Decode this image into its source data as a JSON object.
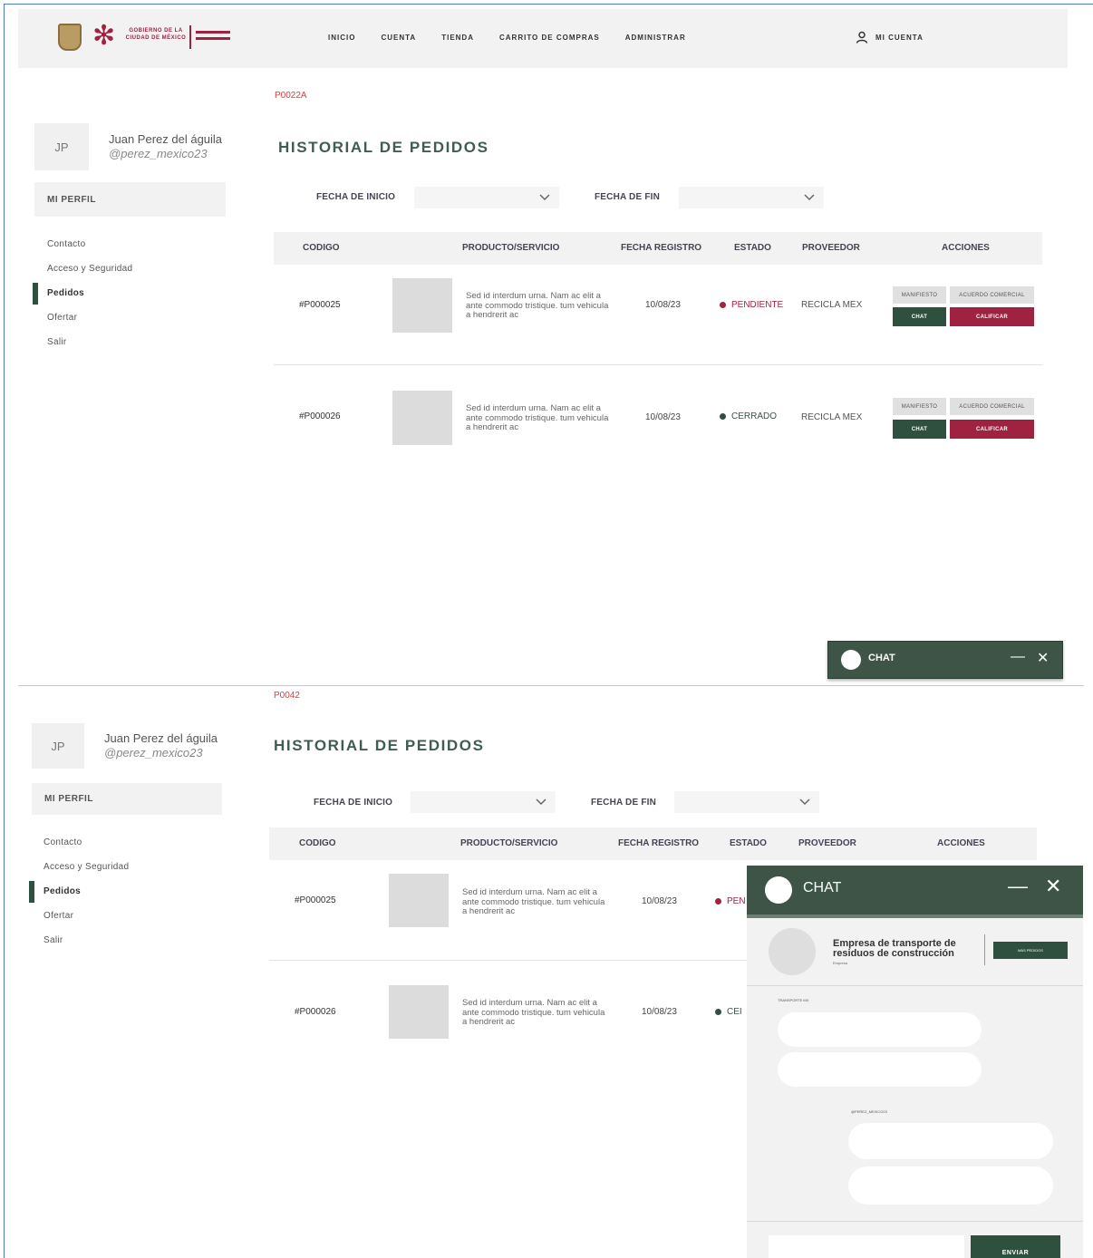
{
  "nav": {
    "logo_text": "GOBIERNO DE LA CIUDAD DE MÉXICO",
    "links": [
      "INICIO",
      "CUENTA",
      "TIENDA",
      "CARRITO DE COMPRAS",
      "ADMINISTRAR"
    ],
    "account_label": "MI CUENTA"
  },
  "frames": [
    {
      "code": "P0022A",
      "user": {
        "initials": "JP",
        "name": "Juan Perez del águila",
        "handle": "@perez_mexico23"
      },
      "profile_button": "MI PERFIL",
      "menu": [
        {
          "label": "Contacto",
          "active": false
        },
        {
          "label": "Acceso y Seguridad",
          "active": false
        },
        {
          "label": "Pedidos",
          "active": true
        },
        {
          "label": "Ofertar",
          "active": false
        },
        {
          "label": "Salir",
          "active": false
        }
      ],
      "title": "HISTORIAL DE PEDIDOS",
      "filters": {
        "start_label": "FECHA DE INICIO",
        "end_label": "FECHA DE FIN"
      },
      "columns": [
        "CODIGO",
        "PRODUCTO/SERVICIO",
        "FECHA REGISTRO",
        "ESTADO",
        "PROVEEDOR",
        "ACCIONES"
      ],
      "rows": [
        {
          "code": "#P000025",
          "description": "Sed id interdum urna. Nam ac elit a ante commodo tristique. tum vehicula a hendrerit ac",
          "date": "10/08/23",
          "status": "PENDIENTE",
          "provider": "RECICLA MEX",
          "actions": {
            "manifest": "MANIFIESTO",
            "agreement": "ACUERDO COMERCIAL",
            "chat": "CHAT",
            "rate": "CALIFICAR"
          }
        },
        {
          "code": "#P000026",
          "description": "Sed id interdum urna. Nam ac elit a ante commodo tristique. tum vehicula a hendrerit ac",
          "date": "10/08/23",
          "status": "CERRADO",
          "provider": "RECICLA MEX",
          "actions": {
            "manifest": "MANIFIESTO",
            "agreement": "ACUERDO COMERCIAL",
            "chat": "CHAT",
            "rate": "CALIFICAR"
          }
        }
      ],
      "chat_title": "CHAT"
    },
    {
      "code": "P0042",
      "user": {
        "initials": "JP",
        "name": "Juan Perez del águila",
        "handle": "@perez_mexico23"
      },
      "profile_button": "MI PERFIL",
      "menu": [
        {
          "label": "Contacto",
          "active": false
        },
        {
          "label": "Acceso y Seguridad",
          "active": false
        },
        {
          "label": "Pedidos",
          "active": true
        },
        {
          "label": "Ofertar",
          "active": false
        },
        {
          "label": "Salir",
          "active": false
        }
      ],
      "title": "HISTORIAL DE PEDIDOS",
      "filters": {
        "start_label": "FECHA DE INICIO",
        "end_label": "FECHA DE FIN"
      },
      "columns": [
        "CODIGO",
        "PRODUCTO/SERVICIO",
        "FECHA REGISTRO",
        "ESTADO",
        "PROVEEDOR",
        "ACCIONES"
      ],
      "rows": [
        {
          "code": "#P000025",
          "description": "Sed id interdum urna. Nam ac elit a ante commodo tristique. tum vehicula a hendrerit ac",
          "date": "10/08/23",
          "status": "PEN"
        },
        {
          "code": "#P000026",
          "description": "Sed id interdum urna. Nam ac elit a ante commodo tristique. tum vehicula a hendrerit ac",
          "date": "10/08/23",
          "status": "CEI"
        }
      ],
      "chat": {
        "title": "CHAT",
        "company": "Empresa de transporte de residuos de construcción",
        "company_sub": "Empresa",
        "more_button": "MÁS PEDIDOS",
        "sender_1": "TRANSPORTE MX",
        "sender_2": "@PEREZ_MEXICO23",
        "send_button": "ENVIAR"
      }
    }
  ],
  "colors": {
    "primary_green": "#2f4f3f",
    "title_green": "#3f5d51",
    "brand_red": "#9f2241",
    "pending": "#9f2241",
    "closed": "#2f4f3f",
    "code_red": "#e03c3c"
  }
}
